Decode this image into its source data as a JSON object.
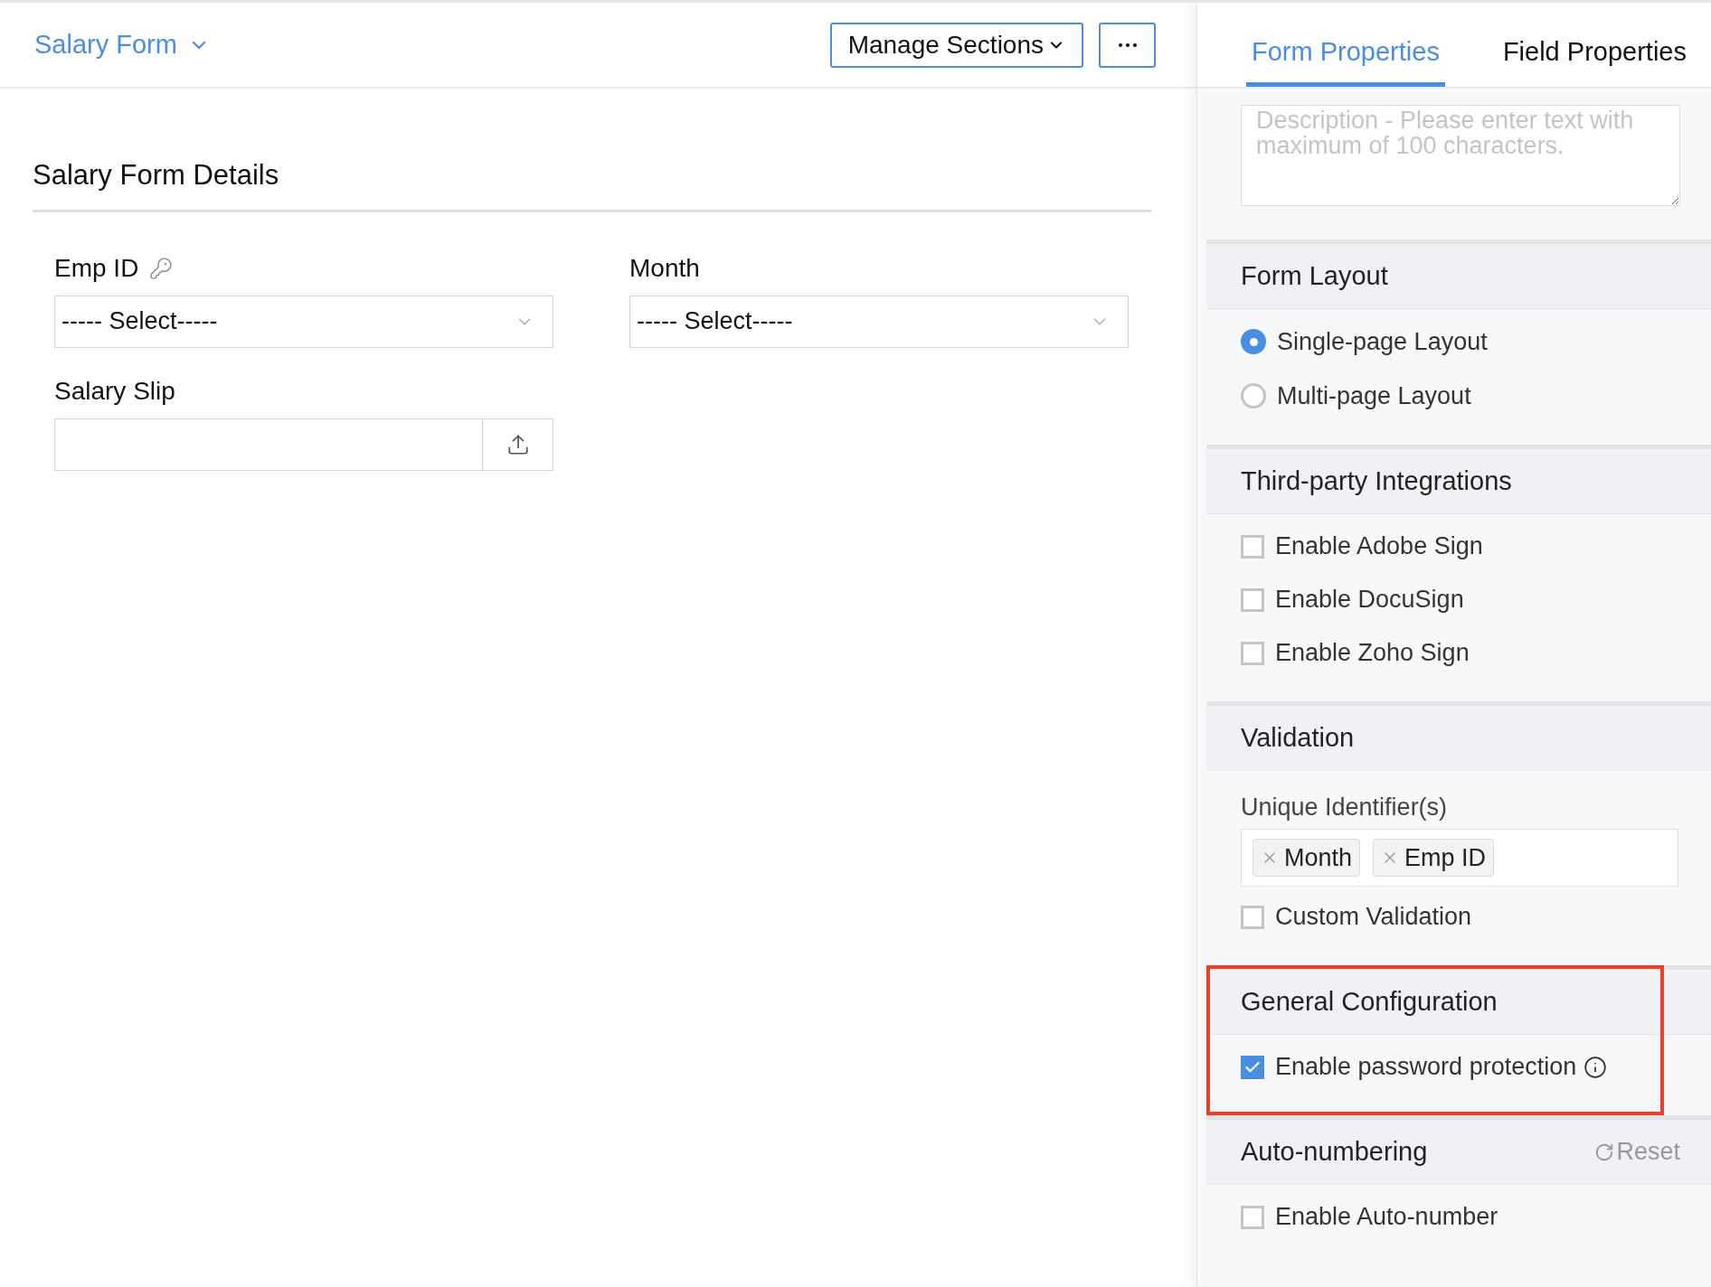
{
  "header": {
    "form_title": "Salary Form",
    "manage_button": "Manage Sections"
  },
  "section": {
    "title": "Salary Form Details",
    "fields": [
      {
        "kind": "select",
        "label": "Emp ID",
        "key_icon": true,
        "value": "----- Select-----"
      },
      {
        "kind": "select",
        "label": "Month",
        "key_icon": false,
        "value": "----- Select-----"
      },
      {
        "kind": "file",
        "label": "Salary Slip",
        "key_icon": false
      }
    ]
  },
  "panel": {
    "tabs": [
      {
        "label": "Form Properties",
        "selected": true
      },
      {
        "label": "Field Properties",
        "selected": false
      }
    ],
    "description": {
      "placeholder": "Description - Please enter text with maximum of 100 characters."
    },
    "sections": [
      {
        "title": "Form Layout",
        "highlighted": false,
        "items": [
          {
            "kind": "radio",
            "label": "Single-page Layout",
            "selected": true
          },
          {
            "kind": "radio",
            "label": "Multi-page Layout",
            "selected": false
          }
        ]
      },
      {
        "title": "Third-party Integrations",
        "highlighted": false,
        "items": [
          {
            "kind": "checkbox",
            "label": "Enable Adobe Sign",
            "checked": false
          },
          {
            "kind": "checkbox",
            "label": "Enable DocuSign",
            "checked": false
          },
          {
            "kind": "checkbox",
            "label": "Enable Zoho Sign",
            "checked": false
          }
        ]
      },
      {
        "title": "Validation",
        "highlighted": false,
        "items": [
          {
            "kind": "tags",
            "label": "Unique Identifier(s)",
            "tags": [
              "Month",
              "Emp ID"
            ]
          },
          {
            "kind": "checkbox",
            "label": "Custom Validation",
            "checked": false
          }
        ]
      },
      {
        "title": "General Configuration",
        "highlighted": true,
        "items": [
          {
            "kind": "checkbox",
            "label": "Enable password protection",
            "checked": true,
            "info": true
          }
        ]
      },
      {
        "title": "Auto-numbering",
        "highlighted": false,
        "reset": "Reset",
        "items": [
          {
            "kind": "checkbox",
            "label": "Enable Auto-number",
            "checked": false
          }
        ]
      }
    ]
  }
}
